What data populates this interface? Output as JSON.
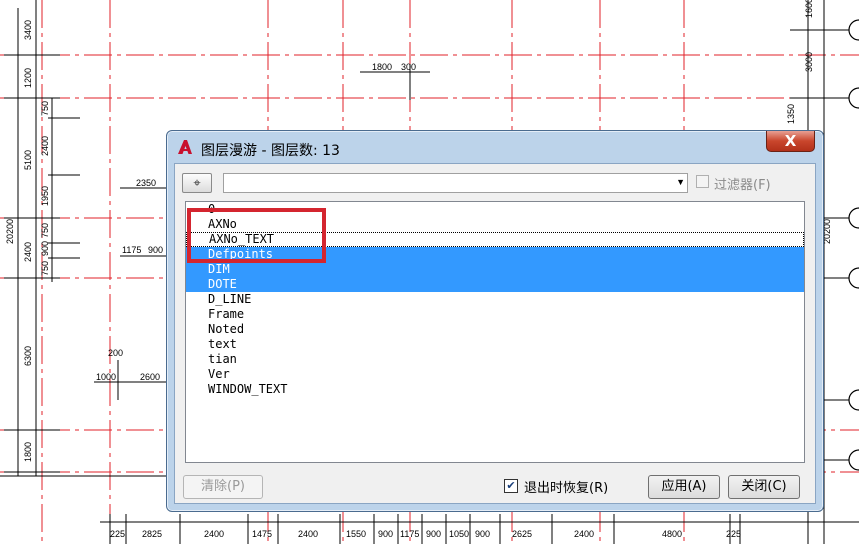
{
  "drawing": {
    "dims_top": [
      "1800",
      "300"
    ],
    "dims_left_outer": [
      "3400",
      "1200",
      "5100",
      "20200",
      "2400",
      "6300",
      "1800"
    ],
    "dims_left_inner": [
      "750",
      "2400",
      "1950",
      "750",
      "900",
      "750"
    ],
    "dims_plan": [
      "2350",
      "1175",
      "900",
      "200",
      "1000",
      "2600"
    ],
    "dims_bottom": [
      "225",
      "2825",
      "2400",
      "1475",
      "2400",
      "1550",
      "900",
      "1175",
      "900",
      "1050",
      "900",
      "2625",
      "2400",
      "4800",
      "225"
    ],
    "dims_right": [
      "1600",
      "3000",
      "1350",
      "20200"
    ]
  },
  "dialog": {
    "app_icon": "autocad-icon",
    "title": "图层漫游 - 图层数: 13",
    "close_glyph": "X",
    "pick_glyph": "⌖",
    "filter_value": "",
    "filter_label": "过滤器(F)",
    "filter_checked": false,
    "layers": [
      {
        "name": "0",
        "selected": false
      },
      {
        "name": "AXNo",
        "selected": false
      },
      {
        "name": "AXNo_TEXT",
        "selected": false,
        "focused": true
      },
      {
        "name": "Defpoints",
        "selected": true
      },
      {
        "name": "DIM",
        "selected": true
      },
      {
        "name": "DOTE",
        "selected": true
      },
      {
        "name": "D_LINE",
        "selected": false
      },
      {
        "name": "Frame",
        "selected": false
      },
      {
        "name": "Noted",
        "selected": false
      },
      {
        "name": "text",
        "selected": false
      },
      {
        "name": "tian",
        "selected": false
      },
      {
        "name": "Ver",
        "selected": false
      },
      {
        "name": "WINDOW_TEXT",
        "selected": false
      }
    ],
    "clear_label": "清除(P)",
    "restore_label": "退出时恢复(R)",
    "restore_checked": true,
    "apply_label": "应用(A)",
    "close_label": "关闭(C)"
  },
  "colors": {
    "selection": "#3399ff",
    "annotation_box": "#d4252f",
    "cad_red": "#e0202a"
  }
}
